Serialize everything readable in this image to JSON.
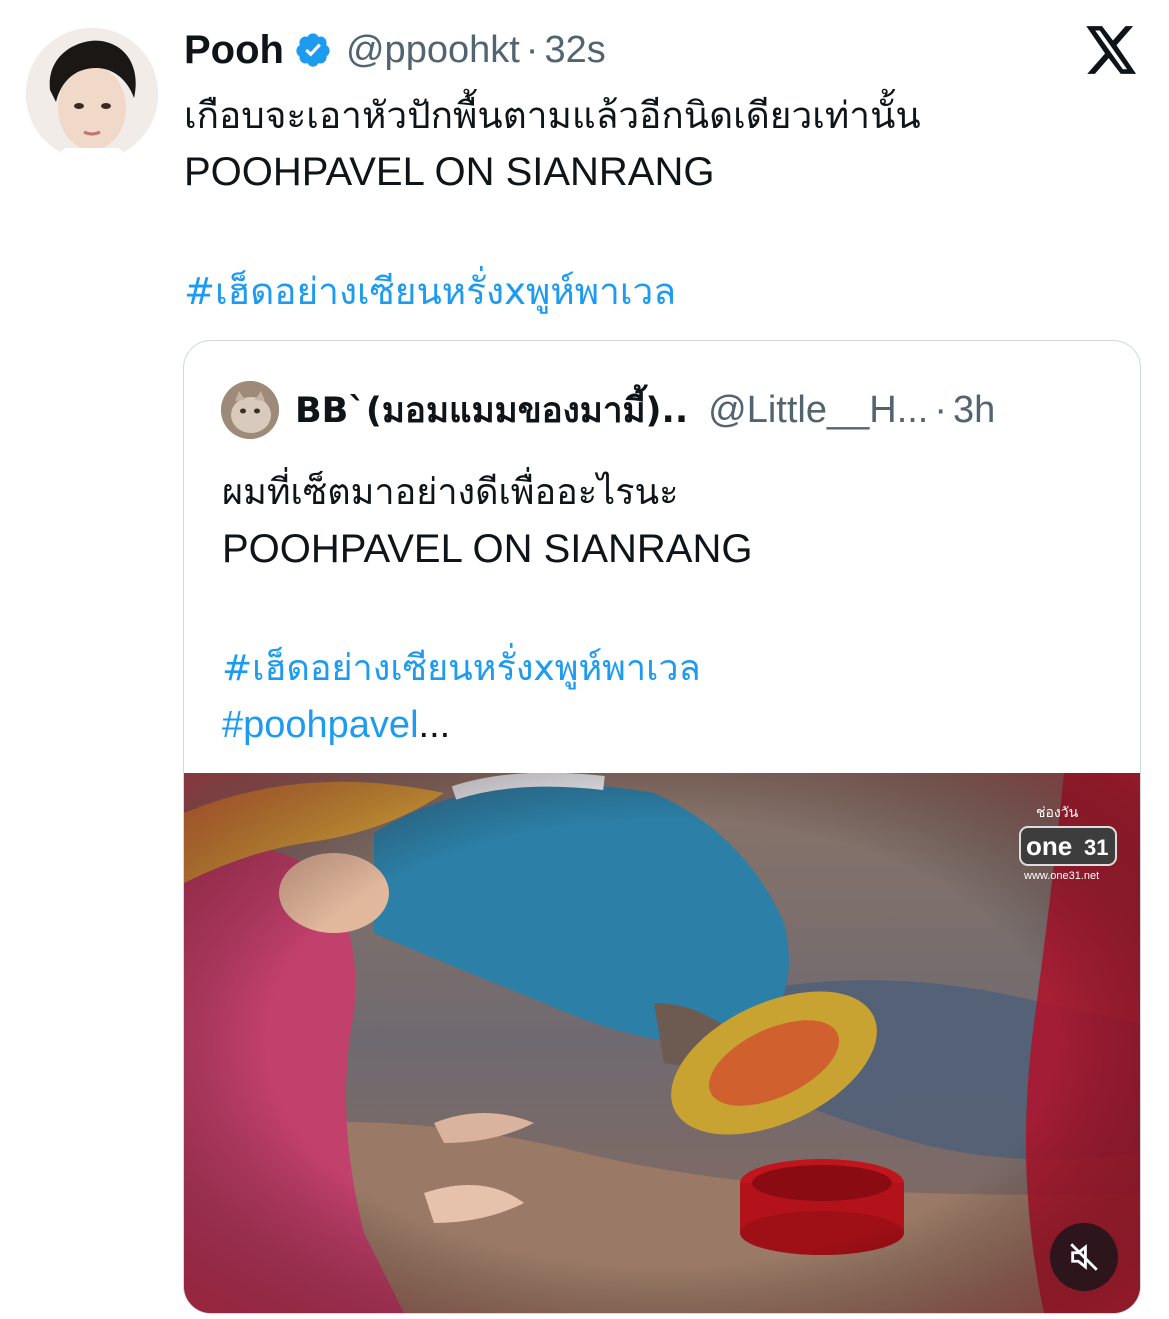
{
  "author": {
    "display_name": "Pooh",
    "handle": "@ppoohkt",
    "separator": "·",
    "time": "32s",
    "verified": true
  },
  "tweet": {
    "line1": "เกือบจะเอาหัวปักพื้นตามแล้วอีกนิดเดียวเท่านั้น",
    "line2": "POOHPAVEL ON SIANRANG",
    "hashtag": "#เฮ็ดอย่างเซียนหรั่งxพูห์พาเวล"
  },
  "quoted": {
    "display_name": "BB`(มอมแมมของมามี้)..",
    "handle": "@Little__H...",
    "separator": "·",
    "time": "3h",
    "line1": "ผมที่เซ็ตมาอย่างดีเพื่ออะไรนะ",
    "line2": "POOHPAVEL ON SIANRANG",
    "hashtag1": "#เฮ็ดอย่างเซียนหรั่งxพูห์พาเวล",
    "hashtag2": "#poohpavel",
    "ellipsis": "...",
    "media": {
      "channel_top": "ช่องวัน",
      "channel_logo": "one",
      "channel_num": "31",
      "channel_url": "www.one31.net",
      "mute_icon": "speaker-muted-icon"
    }
  },
  "colors": {
    "link": "#1d9bf0",
    "verified": "#1d9bf0",
    "secondary_text": "#536471",
    "border": "#cfd9de"
  }
}
